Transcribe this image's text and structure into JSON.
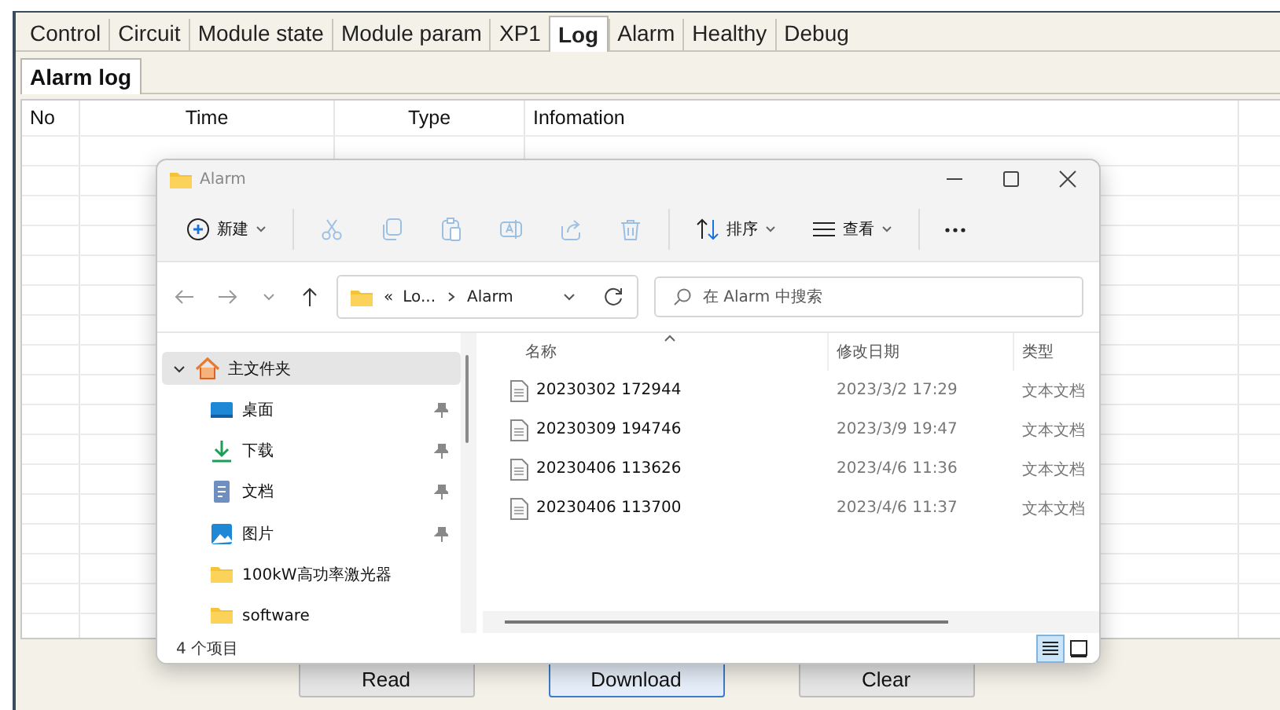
{
  "app": {
    "tabs": [
      {
        "label": "Control",
        "selected": false
      },
      {
        "label": "Circuit",
        "selected": false
      },
      {
        "label": "Module state",
        "selected": false
      },
      {
        "label": "Module param",
        "selected": false
      },
      {
        "label": "XP1",
        "selected": false
      },
      {
        "label": "Log",
        "selected": true
      },
      {
        "label": "Alarm",
        "selected": false
      },
      {
        "label": "Healthy",
        "selected": false
      },
      {
        "label": "Debug",
        "selected": false
      }
    ],
    "subtabs": [
      {
        "label": "Alarm log",
        "selected": true
      }
    ],
    "grid": {
      "columns": [
        "No",
        "Time",
        "Type",
        "Infomation"
      ]
    },
    "buttons": [
      {
        "label": "Read",
        "focused": false
      },
      {
        "label": "Download",
        "focused": true
      },
      {
        "label": "Clear",
        "focused": false
      }
    ]
  },
  "explorer": {
    "title": "Alarm",
    "toolbar": [
      {
        "kind": "new",
        "label": "新建",
        "disabled": false
      },
      {
        "kind": "cut",
        "disabled": true
      },
      {
        "kind": "copy",
        "disabled": true
      },
      {
        "kind": "paste",
        "disabled": true
      },
      {
        "kind": "rename",
        "disabled": true
      },
      {
        "kind": "share",
        "disabled": true
      },
      {
        "kind": "delete",
        "disabled": true
      },
      {
        "kind": "sort",
        "label": "排序",
        "disabled": false
      },
      {
        "kind": "view",
        "label": "查看",
        "disabled": false
      },
      {
        "kind": "more",
        "disabled": false
      }
    ],
    "address": {
      "prefix": "«",
      "crumbs": [
        "Lo...",
        "Alarm"
      ]
    },
    "search": {
      "placeholder": "在 Alarm 中搜索"
    },
    "sidebar": [
      {
        "kind": "home",
        "label": "主文件夹",
        "expanded": true,
        "selected": true,
        "children": [
          {
            "kind": "desktop",
            "label": "桌面",
            "pinned": true,
            "selected": false
          },
          {
            "kind": "download",
            "label": "下载",
            "pinned": true,
            "selected": false
          },
          {
            "kind": "document",
            "label": "文档",
            "pinned": true,
            "selected": false
          },
          {
            "kind": "picture",
            "label": "图片",
            "pinned": true,
            "selected": false
          },
          {
            "kind": "folder",
            "label": "100kW高功率激光器",
            "pinned": false,
            "selected": false
          },
          {
            "kind": "folder",
            "label": "software",
            "pinned": false,
            "selected": false
          }
        ]
      }
    ],
    "columns": [
      "名称",
      "修改日期",
      "类型"
    ],
    "files": [
      {
        "name": "20230302 172944",
        "date": "2023/3/2 17:29",
        "type": "文本文档"
      },
      {
        "name": "20230309 194746",
        "date": "2023/3/9 19:47",
        "type": "文本文档"
      },
      {
        "name": "20230406 113626",
        "date": "2023/4/6 11:36",
        "type": "文本文档"
      },
      {
        "name": "20230406 113700",
        "date": "2023/4/6 11:37",
        "type": "文本文档"
      }
    ],
    "status": "4 个项目",
    "views": [
      {
        "kind": "details",
        "selected": true
      },
      {
        "kind": "tiles",
        "selected": false
      }
    ]
  }
}
